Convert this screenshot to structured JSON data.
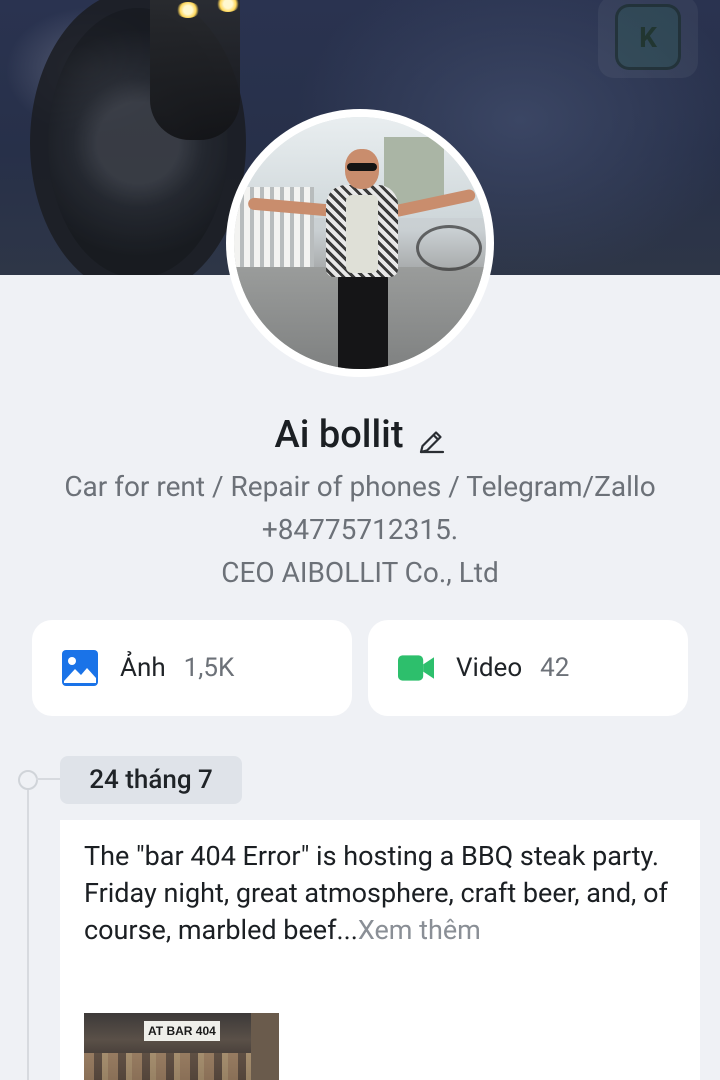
{
  "profile": {
    "name": "Ai bollit",
    "bio_lines": [
      "Car for rent / Repair of phones / Telegram/Zallo",
      "+84775712315.",
      "CEO AIBOLLIT Co., Ltd"
    ]
  },
  "media": {
    "photos": {
      "label": "Ảnh",
      "count": "1,5K",
      "icon": "image-icon",
      "color": "#1a73e8"
    },
    "videos": {
      "label": "Video",
      "count": "42",
      "icon": "video-camera-icon",
      "color": "#2dbf6c"
    }
  },
  "timeline": {
    "date": "24 tháng 7",
    "post": {
      "text_line1": "The \"bar 404 Error\" is hosting a BBQ steak party.",
      "text_line2": "Friday night, great atmosphere, craft beer, and, of course, marbled beef...",
      "more_label": "Xem thêm",
      "image_sign": "AT BAR 404"
    }
  },
  "cover": {
    "badge_letter": "K"
  },
  "colors": {
    "background": "#eff1f5",
    "card": "#ffffff",
    "muted_text": "#6c7178",
    "date_chip": "#dfe3e9"
  }
}
